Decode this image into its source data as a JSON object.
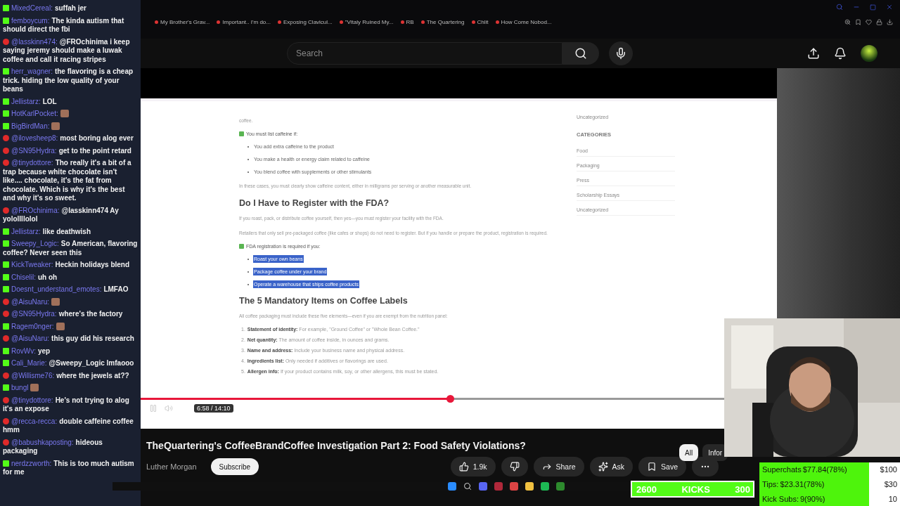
{
  "chat": [
    {
      "kind": "kick",
      "user": "MixedCereal:",
      "text": "suffah jer"
    },
    {
      "kind": "kick",
      "user": "femboycum:",
      "text": "The kinda autism that should direct the fbi"
    },
    {
      "kind": "youtube",
      "user": "@lasskinn474:",
      "text": "@FROchinima i keep saying jeremy should make a luwak coffee and call it racing stripes"
    },
    {
      "kind": "kick",
      "user": "herr_wagner:",
      "text": "the flavoring is a cheap trick. hiding the low quality of your beans"
    },
    {
      "kind": "kick",
      "user": "Jellistarz:",
      "text": "LOL"
    },
    {
      "kind": "kick",
      "user": "HotKarlPocket:",
      "emote": true
    },
    {
      "kind": "kick",
      "user": "BigBirdMan:",
      "emote": true
    },
    {
      "kind": "youtube",
      "user": "@ilovesheep8:",
      "text": "most boring alog ever"
    },
    {
      "kind": "youtube",
      "user": "@SN95Hydra:",
      "text": "get to the point retard"
    },
    {
      "kind": "youtube",
      "user": "@tinydottore:",
      "text": "Tho really it's a bit of a trap because white chocolate isn't like.... chocolate, it's the fat from chocolate. Which is why it's the best and why it's so sweet."
    },
    {
      "kind": "youtube",
      "user": "@FROchinima:",
      "text": "@lasskinn474 Ay yolollllolol"
    },
    {
      "kind": "kick",
      "user": "Jellistarz:",
      "text": "like deathwish"
    },
    {
      "kind": "kick",
      "user": "Sweepy_Logic:",
      "text": "So American, flavoring coffee? Never seen this"
    },
    {
      "kind": "kick",
      "user": "KickTweaker:",
      "text": "Heckin holidays blend"
    },
    {
      "kind": "kick",
      "user": "Chiselil:",
      "text": "uh oh"
    },
    {
      "kind": "kick",
      "user": "Doesnt_understand_emotes:",
      "text": "LMFAO"
    },
    {
      "kind": "youtube",
      "user": "@AisuNaru:",
      "emote": true
    },
    {
      "kind": "youtube",
      "user": "@SN95Hydra:",
      "text": "where's the factory"
    },
    {
      "kind": "kick",
      "user": "Ragem0nger:",
      "emote": true
    },
    {
      "kind": "youtube",
      "user": "@AisuNaru:",
      "text": "this guy did his research"
    },
    {
      "kind": "kick",
      "user": "RovWv:",
      "text": "yep"
    },
    {
      "kind": "kick",
      "user": "Cali_Marie:",
      "text": "@Sweepy_Logic lmfaooo"
    },
    {
      "kind": "youtube",
      "user": "@Willisme76:",
      "text": "where the jewels at??"
    },
    {
      "kind": "kick",
      "user": "bungl",
      "emote": true
    },
    {
      "kind": "youtube",
      "user": "@tinydottore:",
      "text": "He's not trying to alog it's an expose"
    },
    {
      "kind": "youtube",
      "user": "@recca-recca:",
      "text": "double caffeine coffee hmm"
    },
    {
      "kind": "youtube",
      "user": "@babushkaposting:",
      "text": "hideous packaging"
    },
    {
      "kind": "kick",
      "user": "nerdzzworth:",
      "text": "This is too much autism for me"
    }
  ],
  "bookmarks": [
    "My Brother's Grav...",
    "Important.. I'm do...",
    "Exposing Clavicul...",
    "\"Vitaly Ruined My...",
    "RB",
    "The Quartering",
    "Chlit",
    "How Come Nobod..."
  ],
  "youtube_header": {
    "search_placeholder": "Search"
  },
  "article": [
    {
      "kind": "para",
      "text": "coffee."
    },
    {
      "kind": "check",
      "text": "You must list caffeine if:"
    },
    {
      "kind": "bullets",
      "items": [
        {
          "text": "You add extra caffeine to the product",
          "selected": false
        },
        {
          "text": "You make a health or energy claim related to caffeine",
          "selected": false
        },
        {
          "text": "You blend coffee with supplements or other stimulants",
          "selected": false
        }
      ]
    },
    {
      "kind": "para",
      "text": "In these cases, you must clearly show caffeine content, either in milligrams per serving or another measurable unit."
    },
    {
      "kind": "heading",
      "text": "Do I Have to Register with the FDA?"
    },
    {
      "kind": "para",
      "text": "If you roast, pack, or distribute coffee yourself, then yes—you must register your facility with the FDA."
    },
    {
      "kind": "para",
      "text": "Retailers that only sell pre-packaged coffee (like cafes or shops) do not need to register. But if you handle or prepare the product, registration is required."
    },
    {
      "kind": "check",
      "text": "FDA registration is required if you:"
    },
    {
      "kind": "bullets",
      "items": [
        {
          "text": "Roast your own beans",
          "selected": true
        },
        {
          "text": "Package coffee under your brand",
          "selected": true
        },
        {
          "text": "Operate a warehouse that ships coffee products",
          "selected": true
        }
      ]
    },
    {
      "kind": "heading",
      "text": "The 5 Mandatory Items on Coffee Labels"
    },
    {
      "kind": "para",
      "text": "All coffee packaging must include these five elements—even if you are exempt from the nutrition panel:"
    },
    {
      "kind": "numbered",
      "items": [
        {
          "number": "1.",
          "text": "**Statement of identity:** For example, \"Ground Coffee\" or \"Whole Bean Coffee.\""
        },
        {
          "number": "2.",
          "text": "**Net quantity:** The amount of coffee inside, in ounces and grams."
        },
        {
          "number": "3.",
          "text": "**Name and address:** Include your business name and physical address."
        },
        {
          "number": "4.",
          "text": "**Ingredients list:** Only needed if additives or flavorings are used."
        },
        {
          "number": "5.",
          "text": "**Allergen info:** If your product contains milk, soy, or other allergens, this must be stated."
        }
      ]
    }
  ],
  "sidebar": {
    "top_link": "Uncategorized",
    "heading": "CATEGORIES",
    "items": [
      "Food",
      "Packaging",
      "Press",
      "Scholarship Essays",
      "Uncategorized"
    ]
  },
  "player": {
    "level": 0.53,
    "time": "6:58 / 14:10"
  },
  "video": {
    "title": "TheQuartering's CoffeeBrandCoffee Investigation Part 2: Food Safety Violations?",
    "channel": "Luther Morgan",
    "subscribe": "Subscribe",
    "likes": "1.9k",
    "share": "Share",
    "ask": "Ask",
    "save": "Save"
  },
  "chips": [
    {
      "label": "All",
      "selected": true
    },
    {
      "label": "Infor",
      "selected": false
    }
  ],
  "kicks_bar": {
    "count": "2600",
    "label": "KICKS",
    "goal": "300"
  },
  "goals": [
    {
      "label": "Superchats",
      "value": "$77.84(78%)",
      "target": "$100"
    },
    {
      "label": "Tips:",
      "value": "$23.31(78%)",
      "target": "$30"
    },
    {
      "label": "Kick Subs:",
      "value": "9(90%)",
      "target": "10"
    }
  ]
}
